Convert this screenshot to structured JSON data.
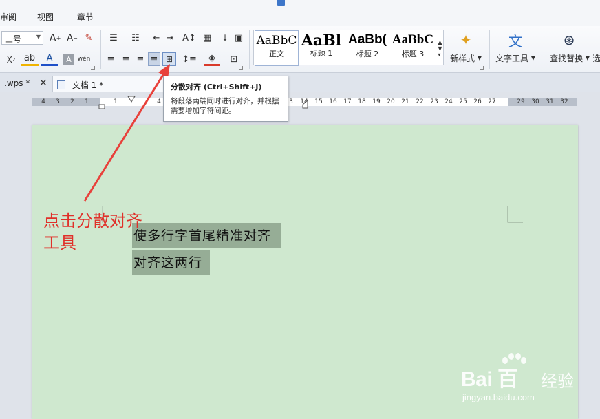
{
  "window": {
    "title": "文档 1"
  },
  "menu": {
    "items": [
      "审阅",
      "视图",
      "章节"
    ]
  },
  "ribbon": {
    "font_size": "三号",
    "styles": [
      {
        "sample": "AaBbC",
        "name": "正文"
      },
      {
        "sample": "AaBl",
        "name": "标题 1"
      },
      {
        "sample": "AaBb(",
        "name": "标题 2"
      },
      {
        "sample": "AaBbC",
        "name": "标题 3"
      }
    ],
    "new_style_label": "新样式",
    "text_tools_label": "文字工具",
    "find_replace_label": "查找替换",
    "extra_label": "选"
  },
  "tabs": [
    {
      "label": ".wps *"
    },
    {
      "label": "文档 1 *"
    }
  ],
  "ruler": {
    "left_numbers": [
      "4",
      "3",
      "2",
      "1"
    ],
    "right_numbers": [
      "1",
      "4"
    ],
    "mid_numbers": [
      "3",
      "14",
      "15",
      "16",
      "17",
      "18",
      "19",
      "20",
      "21",
      "22",
      "23",
      "24",
      "25",
      "26",
      "27"
    ],
    "end_numbers": [
      "29",
      "30",
      "31",
      "32"
    ]
  },
  "tooltip": {
    "title": "分散对齐 (Ctrl+Shift+J)",
    "description": "将段落两端同时进行对齐，并根据需要增加字符间距。"
  },
  "document": {
    "lines": [
      "使多行字首尾精准对齐",
      "对齐这两行"
    ]
  },
  "annotation": {
    "line1": "点击分散对齐",
    "line2": "工具"
  },
  "watermark": {
    "logo": "Bai 百",
    "cn": "经验",
    "url": "jingyan.baidu.com"
  },
  "colors": {
    "page_bg": "#cfe8cf",
    "selection": "#96ad96",
    "annotation": "#e0302a",
    "arrow": "#e8413b"
  }
}
